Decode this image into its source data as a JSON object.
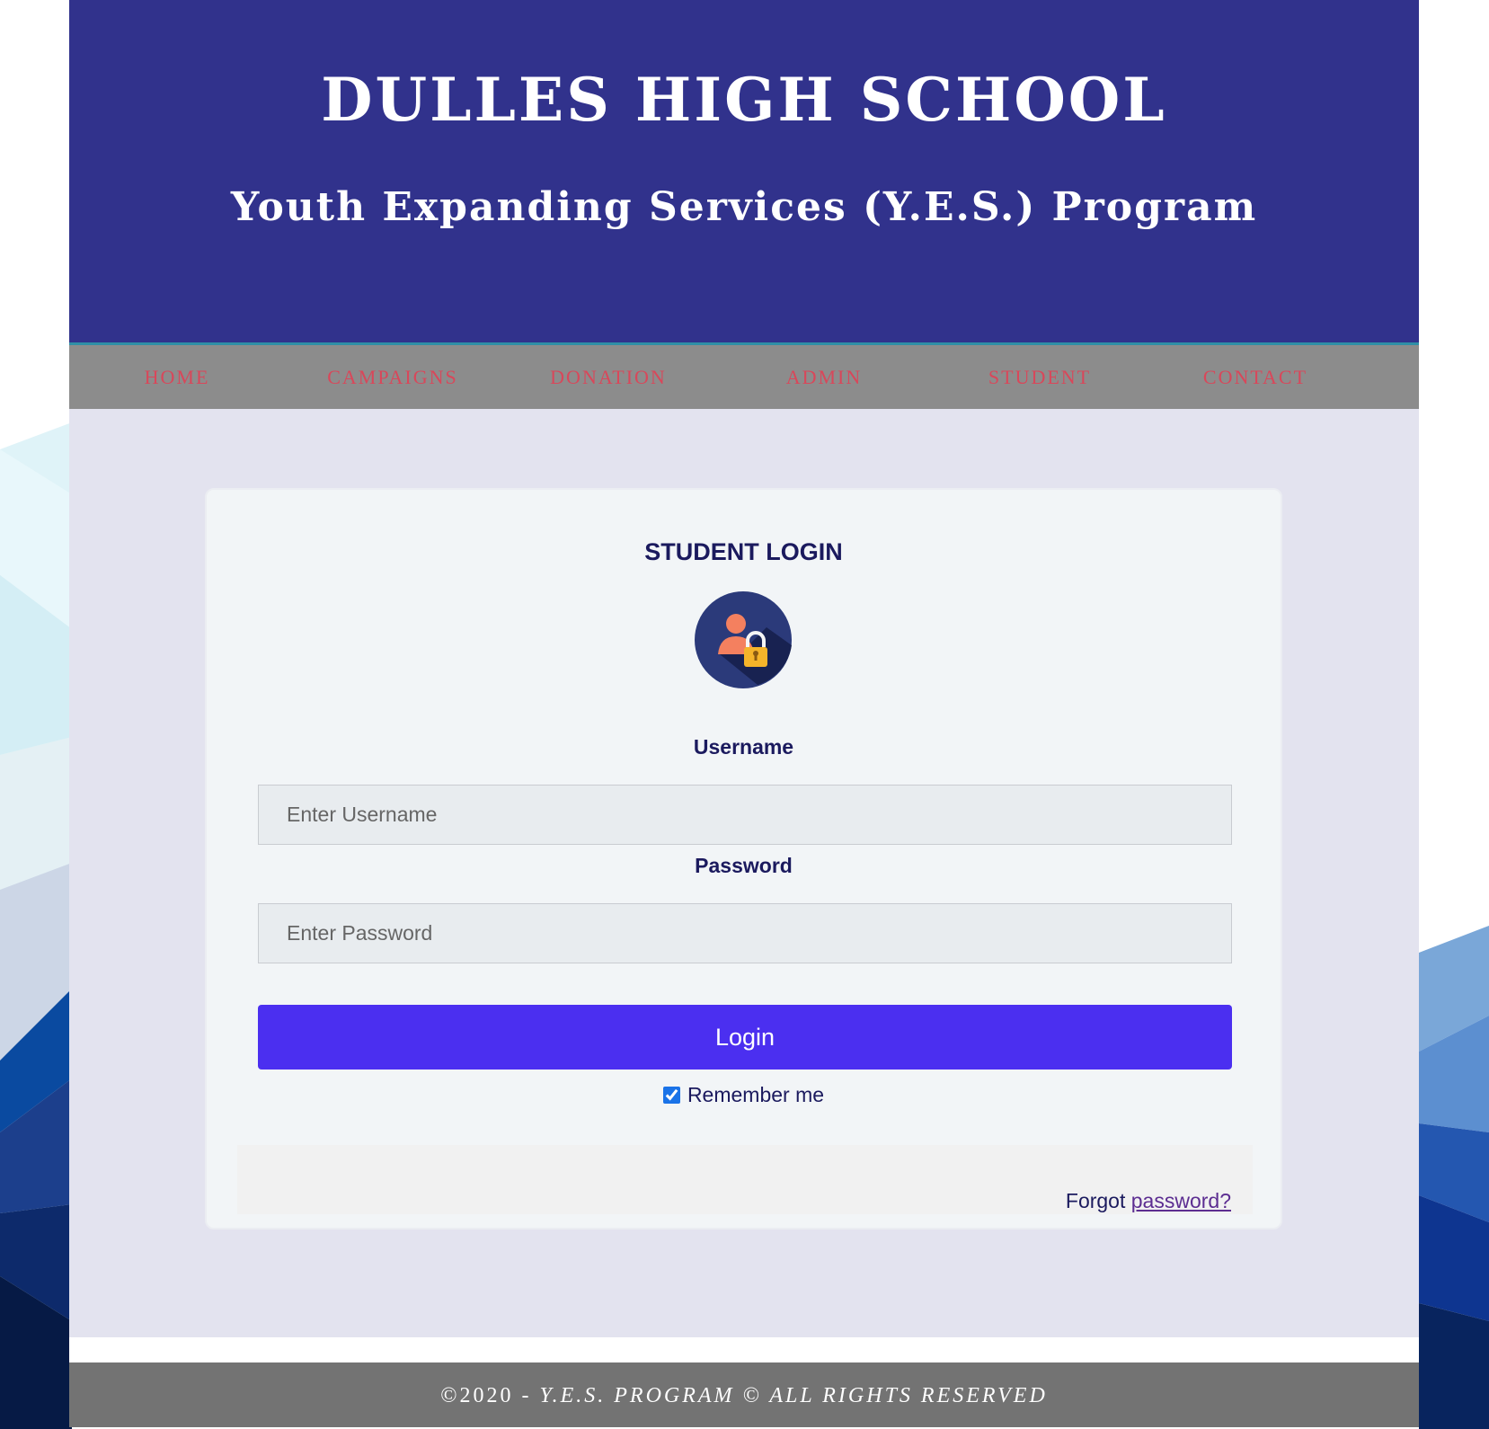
{
  "header": {
    "title": "DULLES HIGH SCHOOL",
    "subtitle": "Youth Expanding Services (Y.E.S.) Program"
  },
  "nav": {
    "items": [
      "HOME",
      "CAMPAIGNS",
      "DONATION",
      "ADMIN",
      "STUDENT",
      "CONTACT"
    ]
  },
  "login": {
    "title": "STUDENT LOGIN",
    "avatar_icon": "user-lock-icon",
    "username_label": "Username",
    "username_placeholder": "Enter Username",
    "password_label": "Password",
    "password_placeholder": "Enter Password",
    "login_button": "Login",
    "remember_label": "Remember me",
    "remember_checked": true,
    "forgot_prefix": "Forgot",
    "forgot_link": "password?"
  },
  "footer": {
    "year": "©2020 - ",
    "text": "Y.E.S. PROGRAM © ALL RIGHTS RESERVED"
  },
  "colors": {
    "header_bg": "#31328c",
    "nav_bg": "#8c8c8c",
    "nav_text": "#d9475a",
    "content_bg": "#e3e3ef",
    "button_bg": "#4b2ff0",
    "footer_bg": "#737373"
  }
}
